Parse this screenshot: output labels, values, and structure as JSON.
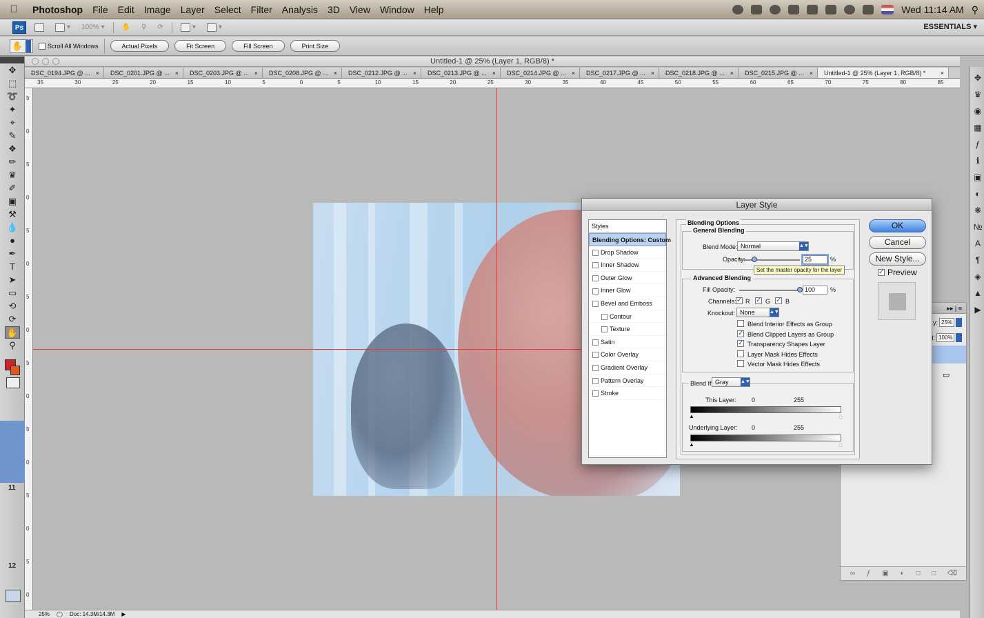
{
  "menubar": {
    "items": [
      "Photoshop",
      "File",
      "Edit",
      "Image",
      "Layer",
      "Select",
      "Filter",
      "Analysis",
      "3D",
      "View",
      "Window",
      "Help"
    ],
    "clock": "Wed 11:14 AM"
  },
  "appbar": {
    "logo": "Ps",
    "zoom": "100%",
    "workspace": "ESSENTIALS"
  },
  "options_bar": {
    "scroll_all_label": "Scroll All Windows",
    "buttons": [
      "Actual Pixels",
      "Fit Screen",
      "Fill Screen",
      "Print Size"
    ]
  },
  "document": {
    "window_title": "Untitled-1 @ 25% (Layer 1, RGB/8) *",
    "tabs": [
      "DSC_0194.JPG @ ...",
      "DSC_0201.JPG @ ...",
      "DSC_0203.JPG @ ...",
      "DSC_0208.JPG @ ...",
      "DSC_0212.JPG @ ...",
      "DSC_0213.JPG @ ...",
      "DSC_0214.JPG @ ...",
      "DSC_0217.JPG @ ...",
      "DSC_0218.JPG @ ...",
      "DSC_0215.JPG @ ...",
      "Untitled-1 @ 25% (Layer 1, RGB/8) *"
    ],
    "ruler_top_labels": [
      "35",
      "30",
      "25",
      "20",
      "15",
      "10",
      "5",
      "0",
      "5",
      "10",
      "15",
      "20",
      "25",
      "30",
      "35",
      "40",
      "45",
      "50",
      "55",
      "60",
      "65",
      "70",
      "75",
      "80",
      "85"
    ],
    "ruler_left_labels": [
      "5",
      "0",
      "5",
      "0",
      "5",
      "0",
      "5",
      "0",
      "5",
      "0",
      "5",
      "0",
      "5",
      "0",
      "5",
      "0"
    ],
    "guide_color": "#e33333"
  },
  "left_panel": {
    "numbers": [
      "11",
      "12"
    ]
  },
  "status_bar": {
    "zoom": "25%",
    "doc_size": "Doc: 14.3M/14.3M"
  },
  "layers_panel": {
    "opacity_label": "y:",
    "opacity_value": "25%",
    "fill_label": "ill:",
    "fill_value": "100%"
  },
  "layer_style_dialog": {
    "title": "Layer Style",
    "styles_header": "Styles",
    "styles": [
      {
        "label": "Blending Options: Custom",
        "checkbox": false,
        "selected": true,
        "indent": false
      },
      {
        "label": "Drop Shadow",
        "checkbox": true,
        "selected": false,
        "indent": false
      },
      {
        "label": "Inner Shadow",
        "checkbox": true,
        "selected": false,
        "indent": false
      },
      {
        "label": "Outer Glow",
        "checkbox": true,
        "selected": false,
        "indent": false
      },
      {
        "label": "Inner Glow",
        "checkbox": true,
        "selected": false,
        "indent": false
      },
      {
        "label": "Bevel and Emboss",
        "checkbox": true,
        "selected": false,
        "indent": false
      },
      {
        "label": "Contour",
        "checkbox": true,
        "selected": false,
        "indent": true
      },
      {
        "label": "Texture",
        "checkbox": true,
        "selected": false,
        "indent": true
      },
      {
        "label": "Satin",
        "checkbox": true,
        "selected": false,
        "indent": false
      },
      {
        "label": "Color Overlay",
        "checkbox": true,
        "selected": false,
        "indent": false
      },
      {
        "label": "Gradient Overlay",
        "checkbox": true,
        "selected": false,
        "indent": false
      },
      {
        "label": "Pattern Overlay",
        "checkbox": true,
        "selected": false,
        "indent": false
      },
      {
        "label": "Stroke",
        "checkbox": true,
        "selected": false,
        "indent": false
      }
    ],
    "blending_options_title": "Blending Options",
    "general_blending_title": "General Blending",
    "blend_mode_label": "Blend Mode:",
    "blend_mode_value": "Normal",
    "opacity_label": "Opacity:",
    "opacity_value": "25",
    "opacity_fraction": 0.25,
    "percent": "%",
    "tooltip": "Set the master opacity for the layer",
    "advanced_blending_title": "Advanced Blending",
    "fill_opacity_label": "Fill Opacity:",
    "fill_opacity_value": "100",
    "fill_fraction": 1.0,
    "channels_label": "Channels:",
    "channels": [
      "R",
      "G",
      "B"
    ],
    "knockout_label": "Knockout:",
    "knockout_value": "None",
    "advanced_checks": [
      {
        "label": "Blend Interior Effects as Group",
        "checked": false
      },
      {
        "label": "Blend Clipped Layers as Group",
        "checked": true
      },
      {
        "label": "Transparency Shapes Layer",
        "checked": true
      },
      {
        "label": "Layer Mask Hides Effects",
        "checked": false
      },
      {
        "label": "Vector Mask Hides Effects",
        "checked": false
      }
    ],
    "blend_if_label": "Blend If:",
    "blend_if_value": "Gray",
    "this_layer_label": "This Layer:",
    "underlying_layer_label": "Underlying Layer:",
    "range_low": "0",
    "range_high": "255",
    "buttons": {
      "ok": "OK",
      "cancel": "Cancel",
      "new_style": "New Style..."
    },
    "preview_label": "Preview",
    "preview_checked": true,
    "accent_color": "#3f84e0"
  }
}
